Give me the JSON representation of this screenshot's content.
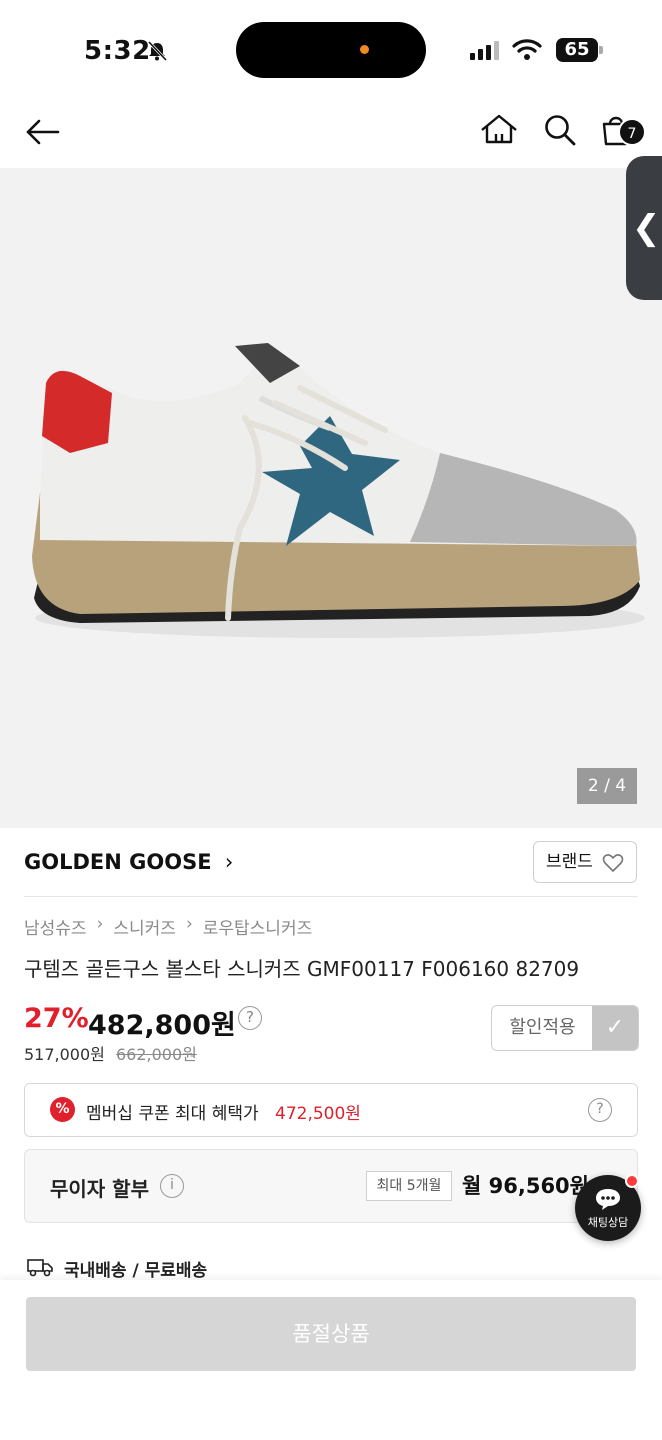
{
  "status_bar": {
    "time": "5:32",
    "battery": "65"
  },
  "nav": {
    "cart_count": "7"
  },
  "gallery": {
    "counter": "2 / 4"
  },
  "brand": {
    "name": "GOLDEN GOOSE",
    "button_label": "브랜드"
  },
  "breadcrumb": [
    "남성슈즈",
    "스니커즈",
    "로우탑스니커즈"
  ],
  "product": {
    "title": "구템즈 골든구스 볼스타 스니커즈 GMF00117 F006160 82709"
  },
  "pricing": {
    "discount": "27%",
    "price": "482,800원",
    "sub_price": "517,000원",
    "original_price": "662,000원",
    "apply_label": "할인적용"
  },
  "coupon": {
    "text": "멤버십 쿠폰 최대 혜택가",
    "amount": "472,500원"
  },
  "installment": {
    "label": "무이자 할부",
    "tag": "최대 5개월",
    "amount": "월 96,560원"
  },
  "chat": {
    "label": "채팅상담"
  },
  "shipping": {
    "text": "국내배송 / 무료배송"
  },
  "footer": {
    "button_label": "품절상품"
  },
  "colors": {
    "accent_red": "#e0202c",
    "disabled_gray": "#d6d6d6"
  }
}
